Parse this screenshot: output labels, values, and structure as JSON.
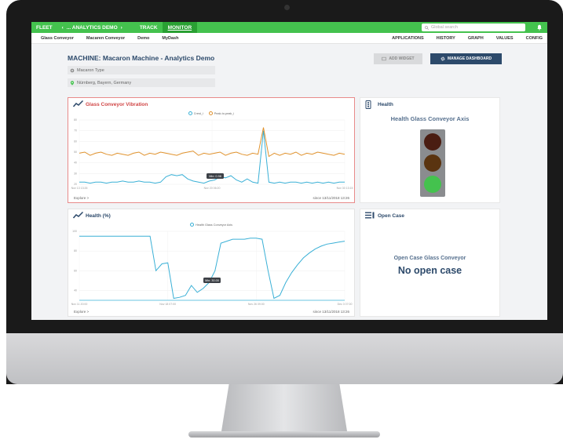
{
  "topbar": {
    "fleet": "FLEET",
    "back": "‹",
    "demo": "... ANALYTICS DEMO",
    "forward": "›",
    "track": "TRACK",
    "monitor": "MONITOR",
    "search_placeholder": "Global search",
    "color": "#44c24e"
  },
  "subnav": {
    "left": [
      "Glass Conveyor",
      "Macaren Conveyor",
      "Demo",
      "MyDash"
    ],
    "right": [
      "APPLICATIONS",
      "HISTORY",
      "GRAPH",
      "VALUES",
      "CONFIG"
    ]
  },
  "machine": {
    "title": "MACHINE: Macaron Machine - Analytics Demo",
    "type": "Macaron Type",
    "location": "Nürnberg, Bayern, Germany"
  },
  "actions": {
    "add_widget": "ADD WIDGET",
    "manage_dashboard": "MANAGE DASHBOARD"
  },
  "vibration": {
    "title": "Glass Conveyor Vibration",
    "legend": [
      "Crest_i",
      "Peak-to-peak_i"
    ],
    "min_label": "Min: 0.98",
    "explore": "Explore >",
    "since": "since 13/11/2018 13:26",
    "colors": {
      "series_a": "#3ab0d6",
      "series_b": "#e0922d",
      "accent": "#d04545"
    }
  },
  "health_chart": {
    "title": "Health (%)",
    "legend": [
      "Health Glass Conveyor Axis"
    ],
    "min_label": "Min: 30.00",
    "explore": "Explore >",
    "since": "since 13/11/2018 13:26"
  },
  "health_light": {
    "title": "Health",
    "subtitle": "Health Glass Conveyor Axis",
    "active": "green"
  },
  "open_case": {
    "title": "Open Case",
    "subtitle": "Open Case Glass Conveyor",
    "status": "No open case"
  },
  "chart_data": [
    {
      "type": "line",
      "title": "Glass Conveyor Vibration",
      "x": [
        "Nov 13 13:26",
        "Nov 20 06:20",
        "Nov 30 13:15"
      ],
      "y_ticks": [
        "80",
        "70",
        "60",
        "50",
        "40",
        "30",
        "20"
      ],
      "series": [
        {
          "name": "Crest_i",
          "values": [
            22,
            22,
            21,
            22,
            22,
            21,
            22,
            22,
            23,
            22,
            22,
            23,
            22,
            22,
            21,
            22,
            27,
            29,
            28,
            29,
            25,
            23,
            22,
            21,
            23,
            24,
            27,
            26,
            28,
            24,
            22,
            25,
            22,
            21,
            70,
            22,
            21,
            22,
            21,
            22,
            22,
            21,
            22,
            21,
            22,
            21,
            22,
            21,
            22,
            22
          ]
        },
        {
          "name": "Peak-to-peak_i",
          "values": [
            49,
            50,
            47,
            49,
            50,
            48,
            47,
            49,
            48,
            47,
            49,
            50,
            47,
            49,
            48,
            50,
            49,
            48,
            47,
            49,
            50,
            51,
            47,
            49,
            48,
            49,
            50,
            47,
            49,
            50,
            48,
            47,
            49,
            48,
            73,
            46,
            49,
            47,
            49,
            48,
            50,
            47,
            49,
            48,
            50,
            49,
            48,
            47,
            49,
            48
          ]
        }
      ],
      "annotation": "Min: 0.98"
    },
    {
      "type": "line",
      "title": "Health (%)",
      "x": [
        "Nov 11 20:00",
        "Nov 18 07:00",
        "Nov 26 09:00",
        "Dec 3 07:00"
      ],
      "y_ticks": [
        "100",
        "80",
        "60",
        "40"
      ],
      "series": [
        {
          "name": "Health Glass Conveyor Axis",
          "values": [
            95,
            95,
            95,
            95,
            95,
            95,
            95,
            95,
            95,
            95,
            95,
            95,
            95,
            60,
            67,
            68,
            32,
            33,
            35,
            45,
            38,
            42,
            48,
            60,
            88,
            90,
            92,
            92,
            92,
            93,
            93,
            92,
            60,
            32,
            35,
            48,
            58,
            66,
            73,
            78,
            82,
            85,
            87,
            88,
            89,
            90
          ]
        }
      ],
      "min_line": 30,
      "annotation": "Min: 30.00"
    }
  ]
}
